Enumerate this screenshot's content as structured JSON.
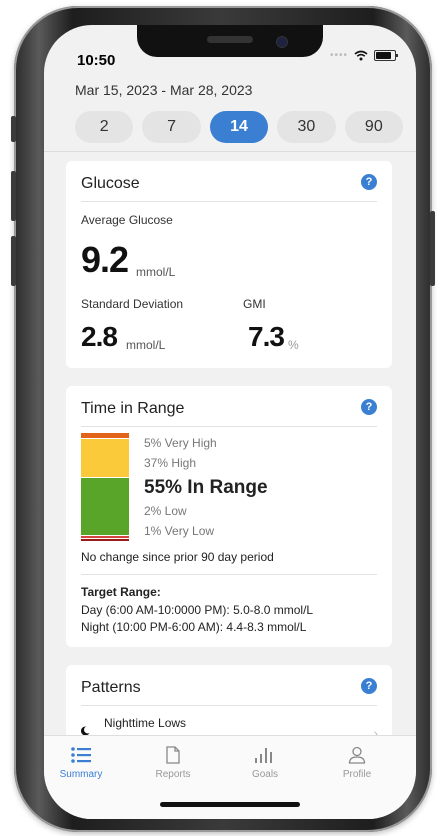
{
  "status": {
    "time": "10:50"
  },
  "date_range": "Mar 15, 2023 - Mar 28, 2023",
  "range_options": [
    "2",
    "7",
    "14",
    "30",
    "90"
  ],
  "selected_range": "14",
  "glucose": {
    "title": "Glucose",
    "help": "?",
    "avg_label": "Average Glucose",
    "avg_value": "9.2",
    "avg_unit": "mmol/L",
    "sd_label": "Standard Deviation",
    "sd_value": "2.8",
    "sd_unit": "mmol/L",
    "gmi_label": "GMI",
    "gmi_value": "7.3",
    "gmi_unit": "%"
  },
  "time_in_range": {
    "title": "Time in Range",
    "help": "?",
    "very_high": "5% Very High",
    "high": "37% High",
    "in_range": "55% In Range",
    "low": "2% Low",
    "very_low": "1% Very Low",
    "segments": [
      {
        "name": "Very High",
        "percent": 5,
        "color": "#e2641b"
      },
      {
        "name": "High",
        "percent": 37,
        "color": "#fbca3a"
      },
      {
        "name": "In Range",
        "percent": 55,
        "color": "#58a52a"
      },
      {
        "name": "Low",
        "percent": 2,
        "color": "#d6443e"
      },
      {
        "name": "Very Low",
        "percent": 1,
        "color": "#9c1c1c"
      }
    ],
    "comparison_note": "No change since prior 90 day period",
    "target_title": "Target Range:",
    "target_day": "Day (6:00 AM-10:0000 PM): 5.0-8.0 mmol/L",
    "target_night": "Night (10:00 PM-6:00 AM): 4.4-8.3 mmol/L"
  },
  "patterns": {
    "title": "Patterns",
    "help": "?",
    "first_item": "Nighttime Lows"
  },
  "tabs": [
    {
      "label": "Summary",
      "icon": "list-icon"
    },
    {
      "label": "Reports",
      "icon": "document-icon"
    },
    {
      "label": "Goals",
      "icon": "bar-chart-icon"
    },
    {
      "label": "Profile",
      "icon": "person-icon"
    }
  ],
  "active_tab": "Summary",
  "colors": {
    "accent": "#3a7fd2"
  }
}
